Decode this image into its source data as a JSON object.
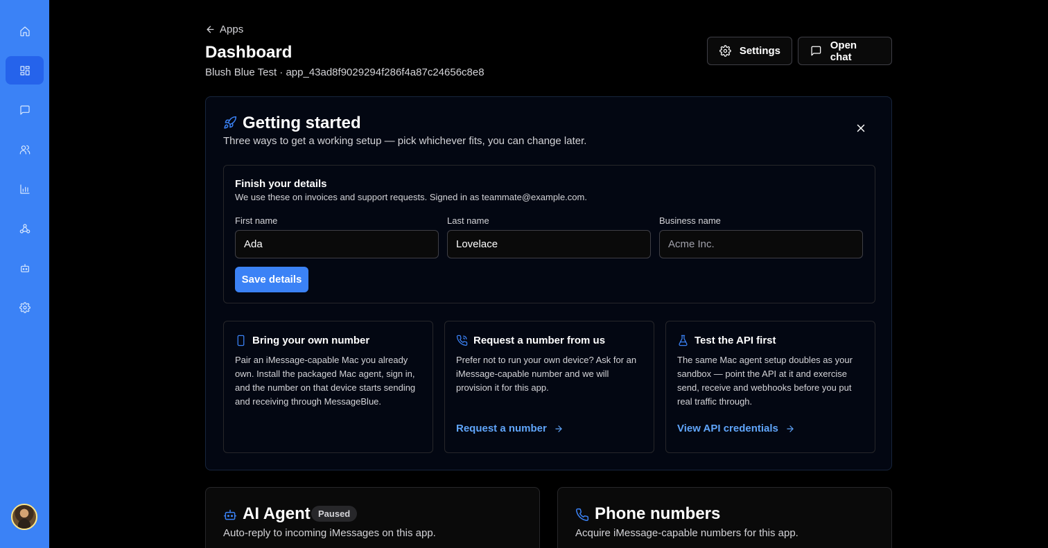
{
  "colors": {
    "sidebar": "#3b82f6",
    "accent": "#3b82f6",
    "link": "#60a5fa",
    "background": "#000000"
  },
  "sidebar": {
    "items": [
      {
        "name": "home-icon"
      },
      {
        "name": "dashboard-icon",
        "active": true
      },
      {
        "name": "chat-icon"
      },
      {
        "name": "users-icon"
      },
      {
        "name": "chart-icon"
      },
      {
        "name": "webhook-icon"
      },
      {
        "name": "bot-icon"
      },
      {
        "name": "gear-icon"
      }
    ]
  },
  "header": {
    "back_label": "Apps",
    "title": "Dashboard",
    "subtitle": "Blush Blue Test · app_43ad8f9029294f286f4a87c24656c8e8",
    "settings_label": "Settings",
    "chat_label": "Open chat"
  },
  "getting_started": {
    "title": "Getting started",
    "description": "Three ways to get a working setup — pick whichever fits, you can change later.",
    "details": {
      "title": "Finish your details",
      "description": "We use these on invoices and support requests. Signed in as teammate@example.com.",
      "first_name_label": "First name",
      "first_name_value": "Ada",
      "last_name_label": "Last name",
      "last_name_value": "Lovelace",
      "business_label": "Business name",
      "business_placeholder": "Acme Inc.",
      "save_label": "Save details"
    },
    "options": [
      {
        "icon": "phone-device-icon",
        "title": "Bring your own number",
        "description": "Pair an iMessage-capable Mac you already own. Install the packaged Mac agent, sign in, and the number on that device starts sending and receiving through MessageBlue."
      },
      {
        "icon": "phone-call-icon",
        "title": "Request a number from us",
        "description": "Prefer not to run your own device? Ask for an iMessage-capable number and we will provision it for this app.",
        "link": "Request a number"
      },
      {
        "icon": "flask-icon",
        "title": "Test the API first",
        "description": "The same Mac agent setup doubles as your sandbox — point the API at it and exercise send, receive and webhooks before you put real traffic through.",
        "link": "View API credentials"
      }
    ]
  },
  "ai_agent": {
    "title": "AI Agent",
    "badge": "Paused",
    "description": "Auto-reply to incoming iMessages on this app."
  },
  "phone_numbers": {
    "title": "Phone numbers",
    "description": "Acquire iMessage-capable numbers for this app."
  }
}
